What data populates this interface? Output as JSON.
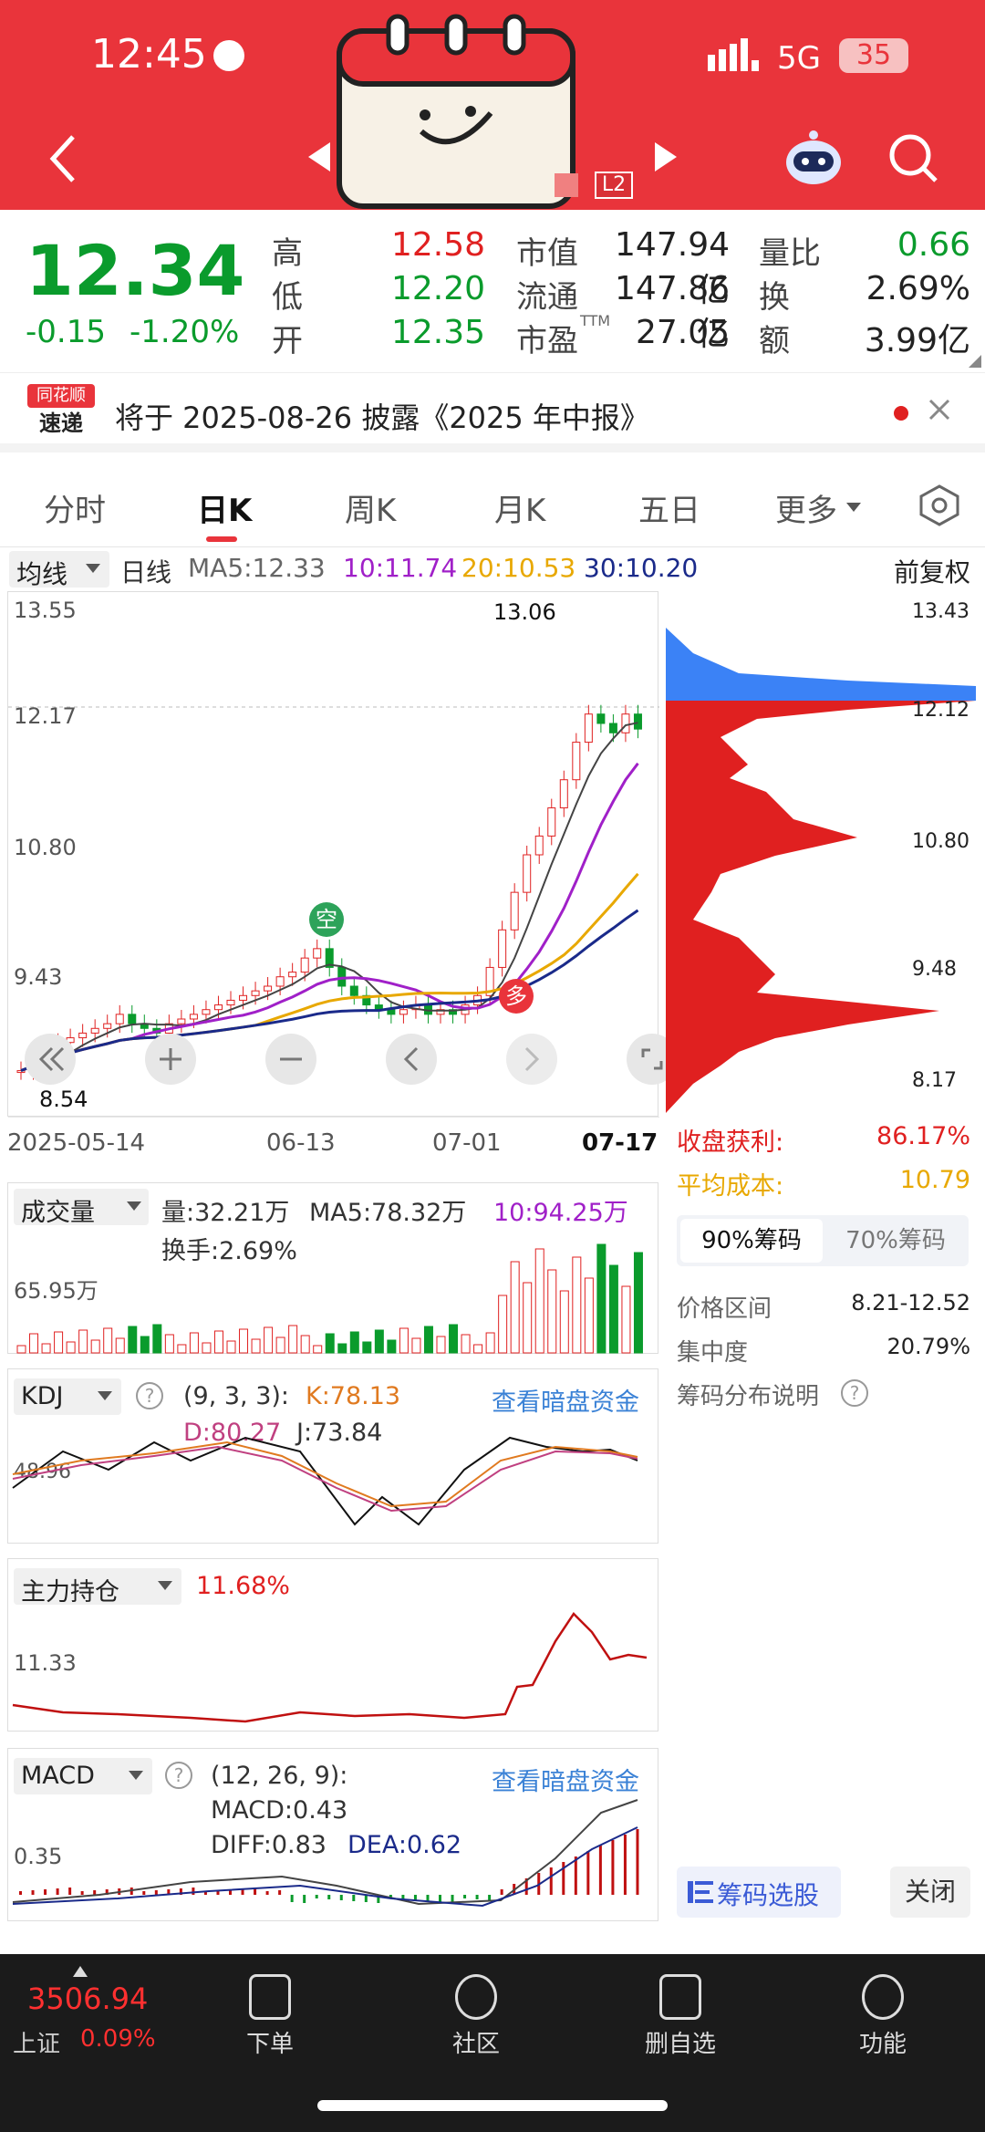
{
  "status": {
    "time": "12:45",
    "network": "5G",
    "battery": "35"
  },
  "header": {
    "level_badge": "L2"
  },
  "quote": {
    "price": "12.34",
    "change": "-0.15",
    "change_pct": "-1.20%",
    "stats": [
      {
        "label": "高",
        "value": "12.58",
        "color": "red"
      },
      {
        "label": "低",
        "value": "12.20",
        "color": "green"
      },
      {
        "label": "开",
        "value": "12.35",
        "color": "green"
      }
    ],
    "stats2": [
      {
        "label": "市值",
        "value": "147.94亿"
      },
      {
        "label": "流通",
        "value": "147.86亿"
      },
      {
        "label": "市盈",
        "sup": "TTM",
        "value": "27.05"
      }
    ],
    "stats3": [
      {
        "label": "量比",
        "value": "0.66",
        "color": "green"
      },
      {
        "label": "换",
        "value": "2.69%"
      },
      {
        "label": "额",
        "value": "3.99亿"
      }
    ]
  },
  "notice": {
    "logo_top": "同花顺",
    "logo_bottom": "速递",
    "text": "将于 2025-08-26 披露《2025 年中报》"
  },
  "tabs": [
    "分时",
    "日K",
    "周K",
    "月K",
    "五日",
    "更多"
  ],
  "active_tab": "日K",
  "kline": {
    "indicator": "均线",
    "period": "日线",
    "ma5": "MA5:12.33",
    "ma10": "10:11.74",
    "ma20": "20:10.53",
    "ma30": "30:10.20",
    "adjust": "前复权",
    "y_labels": [
      "13.55",
      "12.17",
      "10.80",
      "9.43"
    ],
    "max_label": "13.06",
    "min_label": "8.54",
    "dates": [
      "2025-05-14",
      "06-13",
      "07-01",
      "07-17"
    ],
    "badge_short": "空",
    "badge_long": "多",
    "chip_labels": [
      "13.43",
      "12.12",
      "10.80",
      "9.48",
      "8.17"
    ]
  },
  "chip": {
    "profit_label": "收盘获利:",
    "profit": "86.17%",
    "cost_label": "平均成本:",
    "cost": "10.79",
    "tab90": "90%筹码",
    "tab70": "70%筹码",
    "range_label": "价格区间",
    "range": "8.21-12.52",
    "conc_label": "集中度",
    "conc": "20.79%",
    "explain": "筹码分布说明",
    "select_btn": "筹码选股",
    "close_btn": "关闭"
  },
  "volume": {
    "title": "成交量",
    "vol": "量:32.21万",
    "ma5": "MA5:78.32万",
    "ma10": "10:94.25万",
    "turnover": "换手:2.69%",
    "axis": "65.95万"
  },
  "kdj": {
    "title": "KDJ",
    "params": "(9, 3, 3):",
    "k": "K:78.13",
    "d": "D:80.27",
    "j": "J:73.84",
    "axis": "48.96",
    "link": "查看暗盘资金"
  },
  "holding": {
    "title": "主力持仓",
    "value": "11.68%",
    "axis": "11.33"
  },
  "macd": {
    "title": "MACD",
    "params": "(12, 26, 9):",
    "macd": "MACD:0.43",
    "diff": "DIFF:0.83",
    "dea": "DEA:0.62",
    "axis": "0.35",
    "link": "查看暗盘资金"
  },
  "nav": {
    "index_value": "3506.94",
    "index_name": "上证",
    "index_pct": "0.09%",
    "items": [
      "下单",
      "社区",
      "删自选",
      "功能"
    ]
  },
  "colors": {
    "brand": "#e9343b",
    "up": "#e02020",
    "down": "#0a9b2c",
    "blue": "#3b82d6",
    "purple": "#a020c8",
    "orange": "#e8a800",
    "navy": "#1a2a8a"
  }
}
